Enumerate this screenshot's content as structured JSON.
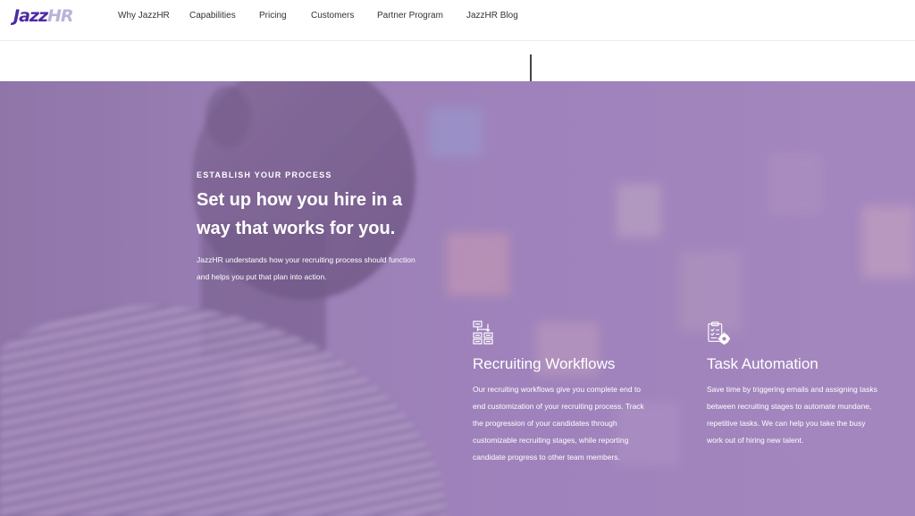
{
  "header": {
    "logo": {
      "primary": "Jazz",
      "secondary": "HR"
    },
    "nav": [
      {
        "label": "Why JazzHR"
      },
      {
        "label": "Capabilities"
      },
      {
        "label": "Pricing"
      },
      {
        "label": "Customers"
      },
      {
        "label": "Partner Program"
      },
      {
        "label": "JazzHR Blog"
      }
    ]
  },
  "hero": {
    "eyebrow": "ESTABLISH YOUR PROCESS",
    "headline": "Set up how you hire in a way that works for you.",
    "intro": "JazzHR understands how your recruiting process should function and helps you put that plan into action.",
    "features": [
      {
        "icon": "workflow-icon",
        "title": "Recruiting Workflows",
        "body": "Our recruiting workflows give you complete end to end customization of your recruiting process. Track the progression of your candidates through customizable recruiting stages, while reporting candidate progress to other team members."
      },
      {
        "icon": "clipboard-gear-icon",
        "title": "Task Automation",
        "body": "Save time by triggering emails and assigning tasks between recruiting stages to automate mundane, repetitive tasks. We can help you take the busy work out of hiring new talent."
      }
    ]
  },
  "colors": {
    "brand": "#4d2aa3",
    "brand_light": "#b8b4d8",
    "hero_tint": "#9d85b8",
    "text_light": "#ffffff"
  }
}
